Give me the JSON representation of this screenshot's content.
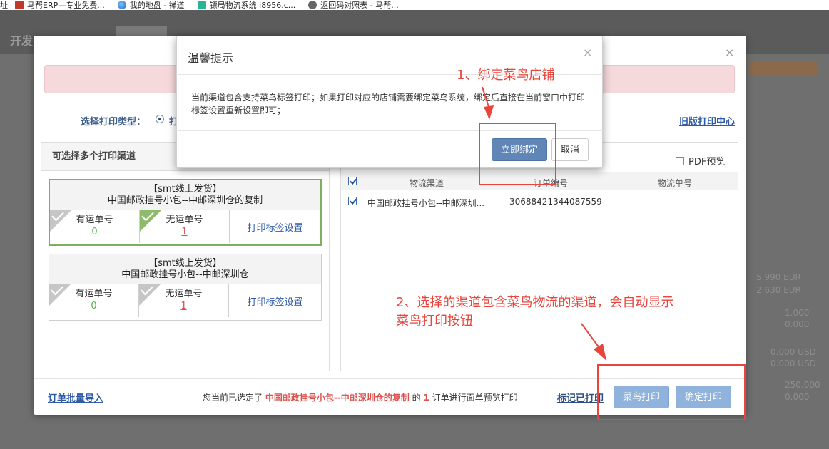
{
  "bookmarks": [
    {
      "label": "址",
      "icon": ""
    },
    {
      "label": "马帮ERP—专业免费...",
      "icon": "mabang-logo-icon"
    },
    {
      "label": "我的地盘 - 禅道",
      "icon": "globe-icon"
    },
    {
      "label": "镖局物流系统 i8956.c...",
      "icon": "biaoju-logo-icon"
    },
    {
      "label": "返回码对照表 - 马帮...",
      "icon": "back-icon"
    }
  ],
  "background": {
    "brand": "开发",
    "numbers": [
      "5.990 EUR",
      "2.630 EUR",
      "1.000",
      "0.000",
      "0.000 USD",
      "0.000 USD",
      "250.000",
      "0.000"
    ]
  },
  "main_dialog": {
    "print_type_label": "选择打印类型：",
    "print_type_option": "打",
    "old_print_center": "旧版打印中心",
    "left_panel": {
      "title": "可选择多个打印渠道",
      "channels": [
        {
          "title_line1": "【smt线上发货】",
          "title_line2": "中国邮政挂号小包--中邮深圳仓的复制",
          "with_tracking_label": "有运单号",
          "with_tracking_count": "0",
          "without_tracking_label": "无运单号",
          "without_tracking_count": "1",
          "settings_link": "打印标签设置"
        },
        {
          "title_line1": "【smt线上发货】",
          "title_line2": "中国邮政挂号小包--中邮深圳仓",
          "with_tracking_label": "有运单号",
          "with_tracking_count": "0",
          "without_tracking_label": "无运单号",
          "without_tracking_count": "1",
          "settings_link": "打印标签设置"
        }
      ]
    },
    "right_panel": {
      "pdf_preview_label": "PDF预览",
      "columns": [
        "物流渠道",
        "订单编号",
        "物流单号"
      ],
      "rows": [
        {
          "channel": "中国邮政挂号小包--中邮深圳...",
          "order_no": "30688421344087559",
          "tracking_no": ""
        }
      ]
    },
    "footer": {
      "batch_import": "订单批量导入",
      "summary_prefix": "您当前已选定了",
      "summary_channel": "中国邮政挂号小包--中邮深圳仓的复制",
      "summary_mid": "的",
      "summary_count": "1",
      "summary_suffix": "订单进行面单预览打印",
      "mark_printed": "标记已打印",
      "cainiao_print": "菜鸟打印",
      "confirm_print": "确定打印"
    }
  },
  "tip_modal": {
    "title": "温馨提示",
    "body": "当前渠道包含支持菜鸟标签打印；如果打印对应的店铺需要绑定菜鸟系统，绑定后直接在当前窗口中打印标签设置重新设置即可；",
    "bind_button": "立即绑定",
    "cancel_button": "取消",
    "close": "×"
  },
  "annotations": {
    "note1": "1、绑定菜鸟店铺",
    "note2_line1": "2、选择的渠道包含菜鸟物流的渠道，会自动显示",
    "note2_line2": "菜鸟打印按钮",
    "color": "#e8453c"
  }
}
